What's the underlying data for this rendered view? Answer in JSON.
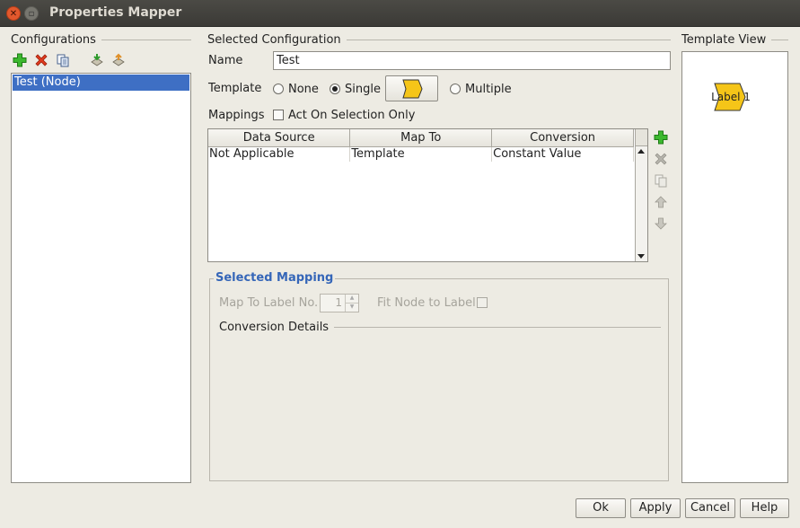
{
  "window": {
    "title": "Properties Mapper"
  },
  "configurations": {
    "header": "Configurations",
    "toolbar_icons": [
      "add-icon",
      "delete-icon",
      "copy-icon",
      "import-icon",
      "export-icon"
    ],
    "items": [
      {
        "label": "Test (Node)",
        "selected": true
      }
    ]
  },
  "selected_configuration": {
    "header": "Selected Configuration",
    "name_label": "Name",
    "name_value": "Test",
    "template_label": "Template",
    "template_options": {
      "none": "None",
      "single": "Single",
      "multiple": "Multiple"
    },
    "template_selected": "single",
    "mappings_label": "Mappings",
    "act_on_selection_label": "Act On Selection Only",
    "act_on_selection_checked": false
  },
  "mappings_table": {
    "columns": [
      "Data Source",
      "Map To",
      "Conversion"
    ],
    "rows": [
      [
        "Not Applicable",
        "Template",
        "Constant Value"
      ]
    ],
    "side_icons": [
      "add-icon",
      "delete-icon",
      "copy-icon",
      "move-up-icon",
      "move-down-icon"
    ]
  },
  "selected_mapping": {
    "header": "Selected Mapping",
    "map_to_label_no_label": "Map To Label No.",
    "map_to_label_no_value": "1",
    "fit_node_label": "Fit Node to Label",
    "conversion_details_label": "Conversion Details"
  },
  "template_view": {
    "header": "Template View",
    "node_label": "Label 1",
    "node_color": "#f5c518"
  },
  "buttons": {
    "ok": "Ok",
    "apply": "Apply",
    "cancel": "Cancel",
    "help": "Help"
  },
  "colors": {
    "selection": "#3e6fc4",
    "accent_header": "#3566b8"
  }
}
